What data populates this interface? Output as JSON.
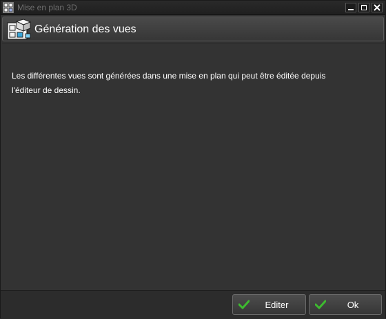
{
  "window": {
    "title": "Mise en plan 3D"
  },
  "header": {
    "title": "Génération des vues",
    "icon": "drawing-views-icon"
  },
  "content": {
    "message_line1": "Les différentes vues sont générées dans une mise en plan qui peut être éditée depuis",
    "message_line2": "l'éditeur de dessin."
  },
  "footer": {
    "edit_label": "Editer",
    "ok_label": "Ok",
    "button_icon": "check-icon"
  },
  "colors": {
    "background": "#333333",
    "check_green": "#3dbb2f"
  }
}
